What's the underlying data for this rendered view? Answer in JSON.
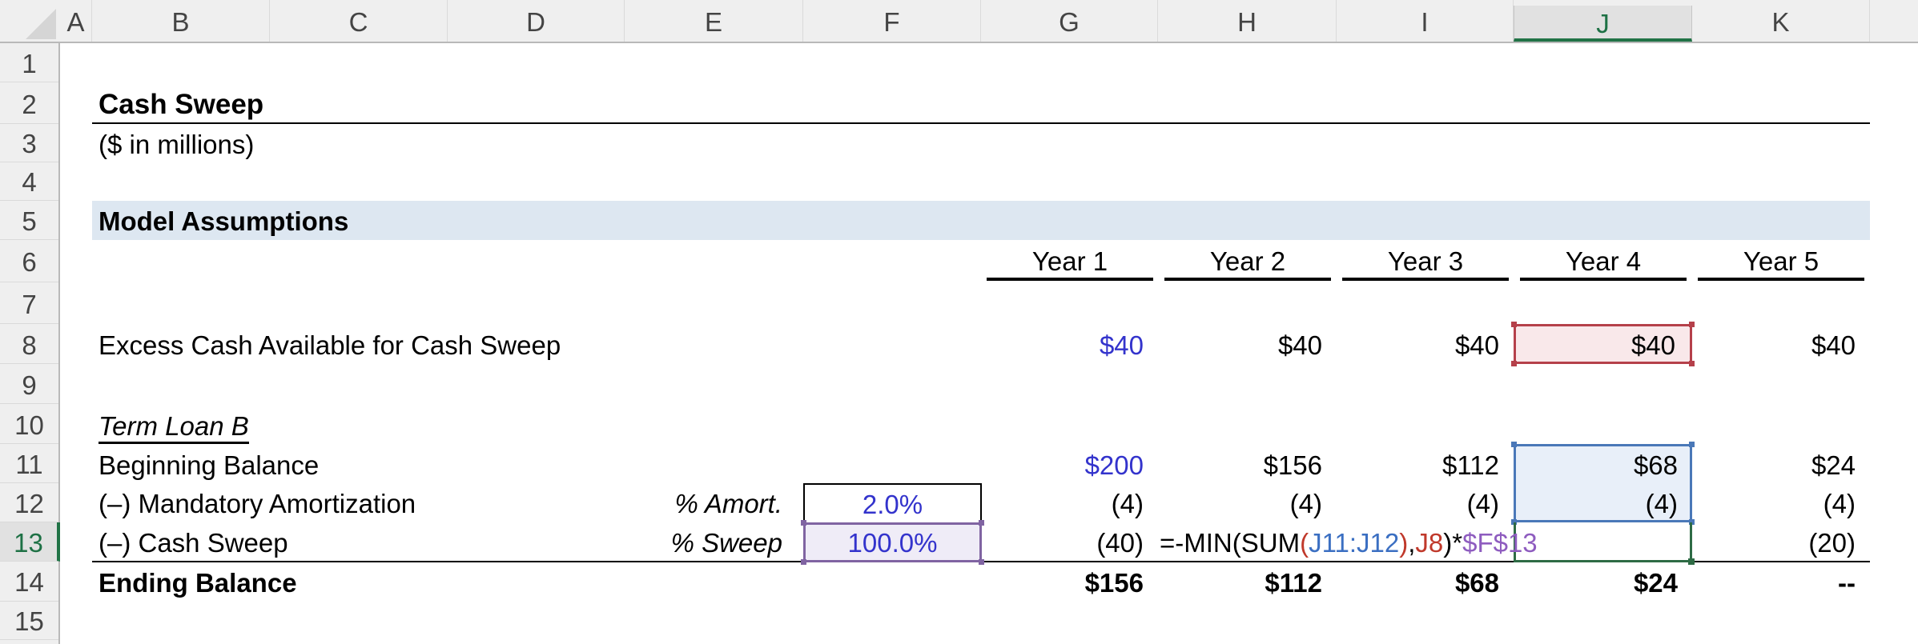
{
  "grid": {
    "columns": [
      "A",
      "B",
      "C",
      "D",
      "E",
      "F",
      "G",
      "H",
      "I",
      "J",
      "K"
    ],
    "selected_column": "J",
    "rows": [
      "1",
      "2",
      "3",
      "4",
      "5",
      "6",
      "7",
      "8",
      "9",
      "10",
      "11",
      "12",
      "13",
      "14",
      "15"
    ],
    "selected_row": "13"
  },
  "title": "Cash Sweep",
  "subtitle": "($ in millions)",
  "section_header": "Model Assumptions",
  "years": [
    "Year 1",
    "Year 2",
    "Year 3",
    "Year 4",
    "Year 5"
  ],
  "excess_cash": {
    "label": "Excess Cash Available for Cash Sweep",
    "values": [
      "$40",
      "$40",
      "$40",
      "$40",
      "$40"
    ]
  },
  "term_loan": {
    "heading": "Term Loan B",
    "beginning_balance": {
      "label": "Beginning Balance",
      "values": [
        "$200",
        "$156",
        "$112",
        "$68",
        "$24"
      ]
    },
    "mandatory_amortization": {
      "label": "(–) Mandatory Amortization",
      "assumption_label": "% Amort.",
      "assumption_value": "2.0%",
      "values": [
        "(4)",
        "(4)",
        "(4)",
        "(4)",
        "(4)"
      ]
    },
    "cash_sweep": {
      "label": "(–) Cash Sweep",
      "assumption_label": "% Sweep",
      "assumption_value": "100.0%",
      "values": [
        "(40)",
        "",
        "",
        "",
        "(20)"
      ]
    },
    "ending_balance": {
      "label": "Ending Balance",
      "values": [
        "$156",
        "$112",
        "$68",
        "$24",
        "--"
      ]
    }
  },
  "formula_edit": {
    "cell": "J13",
    "parts": [
      {
        "text": "=-MIN(SUM",
        "color": "#000000"
      },
      {
        "text": "(",
        "color": "#c0392b"
      },
      {
        "text": "J11:J12",
        "color": "#3b6fc2"
      },
      {
        "text": ")",
        "color": "#c0392b"
      },
      {
        "text": ",",
        "color": "#000000"
      },
      {
        "text": "J8",
        "color": "#c0392b"
      },
      {
        "text": ")*",
        "color": "#000000"
      },
      {
        "text": "$F$13",
        "color": "#8e5cbf"
      }
    ]
  },
  "colors": {
    "input_blue": "#3333cc",
    "section_fill": "#dde7f1",
    "ref_red": "#b5404a",
    "ref_blue": "#4a78b8",
    "ref_purple": "#8064a2",
    "active_green": "#217346"
  }
}
